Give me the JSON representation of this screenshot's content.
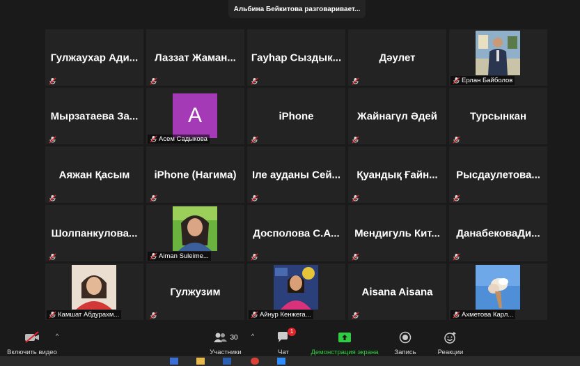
{
  "speaker_banner": "Альбина Бейкитова разговаривает...",
  "tiles": [
    {
      "name": "Гулжаухар Ади...",
      "type": "name"
    },
    {
      "name": "Лаззат Жаман...",
      "type": "name"
    },
    {
      "name": "Гауһар Сыздык...",
      "type": "name"
    },
    {
      "name": "Дәулет",
      "type": "name"
    },
    {
      "name": "Ерлан Байболов",
      "type": "photo-man"
    },
    {
      "name": "Мырзатаева За...",
      "type": "name"
    },
    {
      "name": "Асем Садыкова",
      "type": "avatar",
      "avatar_letter": "A"
    },
    {
      "name": "iPhone",
      "type": "name"
    },
    {
      "name": "Жайнагүл Әдей",
      "type": "name"
    },
    {
      "name": "Турсынкан",
      "type": "name"
    },
    {
      "name": "Аяжан Қасым",
      "type": "name"
    },
    {
      "name": "iPhone (Нагима)",
      "type": "name"
    },
    {
      "name": "Іле ауданы Сей...",
      "type": "name"
    },
    {
      "name": "Қуандық Ғайн...",
      "type": "name"
    },
    {
      "name": "Рысдаулетова...",
      "type": "name"
    },
    {
      "name": "Шолпанкулова...",
      "type": "name"
    },
    {
      "name": "Aiman Suleime...",
      "type": "photo-woman1"
    },
    {
      "name": "Досполова С.А...",
      "type": "name"
    },
    {
      "name": "Мендигуль Кит...",
      "type": "name"
    },
    {
      "name": "ДанабековаДи...",
      "type": "name"
    },
    {
      "name": "Камшат Абдурахм...",
      "type": "photo-woman2"
    },
    {
      "name": "Гулжузим",
      "type": "name"
    },
    {
      "name": "Айнур Кенжега...",
      "type": "photo-woman3"
    },
    {
      "name": "Aisana Aisana",
      "type": "name"
    },
    {
      "name": "Ахметова Карл...",
      "type": "photo-sky"
    }
  ],
  "toolbar": {
    "video_label": "Включить видео",
    "participants_label": "Участники",
    "participants_count": "30",
    "chat_label": "Чат",
    "chat_badge": "1",
    "share_label": "Демонстрация экрана",
    "record_label": "Запись",
    "reactions_label": "Реакции"
  },
  "colors": {
    "background": "#1a1a1a",
    "tile": "#232323",
    "avatar": "#a53ab6",
    "share_green": "#2ecc40",
    "muted_red": "#e0242b"
  },
  "icons": [
    "video-off-icon",
    "participants-icon",
    "chat-icon",
    "share-screen-icon",
    "record-icon",
    "reactions-icon",
    "mic-muted-icon"
  ]
}
